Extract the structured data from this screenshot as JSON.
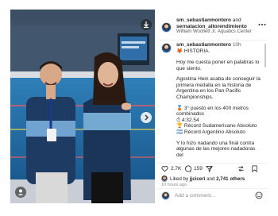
{
  "photo": {
    "alt": "Two people posing with a medal at an aquatics center",
    "icons": {
      "next": "chevron-right-icon",
      "download": "download-icon",
      "tagged": "user-icon"
    }
  },
  "header": {
    "line1_user": "sm_sebastianmontero",
    "line1_and": " and",
    "line2_user": "sernatacion_altorendimiento",
    "location": "William Woollett Jr. Aquatics Center",
    "more_icon": "more-horizontal-icon"
  },
  "caption": {
    "username": "sm_sebastianmontero",
    "time": "10h",
    "intro": "🦊 HISTORIA.",
    "paragraphs": [
      "Hoy me cuesta poner en palabras lo que siento.",
      "Agostina Hein acaba de conseguir la primera medalla en la historia de Argentina en los Pan Pacific Championships.",
      "🥉 3° puesto en los 400 metros combinados\n⏱ 4:32.54\n🏆 Récord Sudamericano Absoluto\n🇦🇷 Récord Argentino Absoluto",
      "Y lo hizo nadando una final contra algunas de las mejores nadadoras del"
    ]
  },
  "actions": {
    "likes": "2.7K",
    "comments": "159",
    "icons": [
      "heart-icon",
      "comment-icon",
      "share-icon",
      "repost-icon",
      "save-icon"
    ]
  },
  "liked_by": {
    "prefix": "Liked by ",
    "user": "jjciceri",
    "middle": " and ",
    "others": "2,741 others"
  },
  "time_ago": "10 hours ago",
  "comment": {
    "placeholder": "Add a comment…",
    "emoji_icon": "smiley-icon"
  },
  "colors": {
    "photo_bg": "#2d4a66",
    "text": "#262626",
    "muted": "#8e8e8e",
    "divider": "#efefef"
  }
}
